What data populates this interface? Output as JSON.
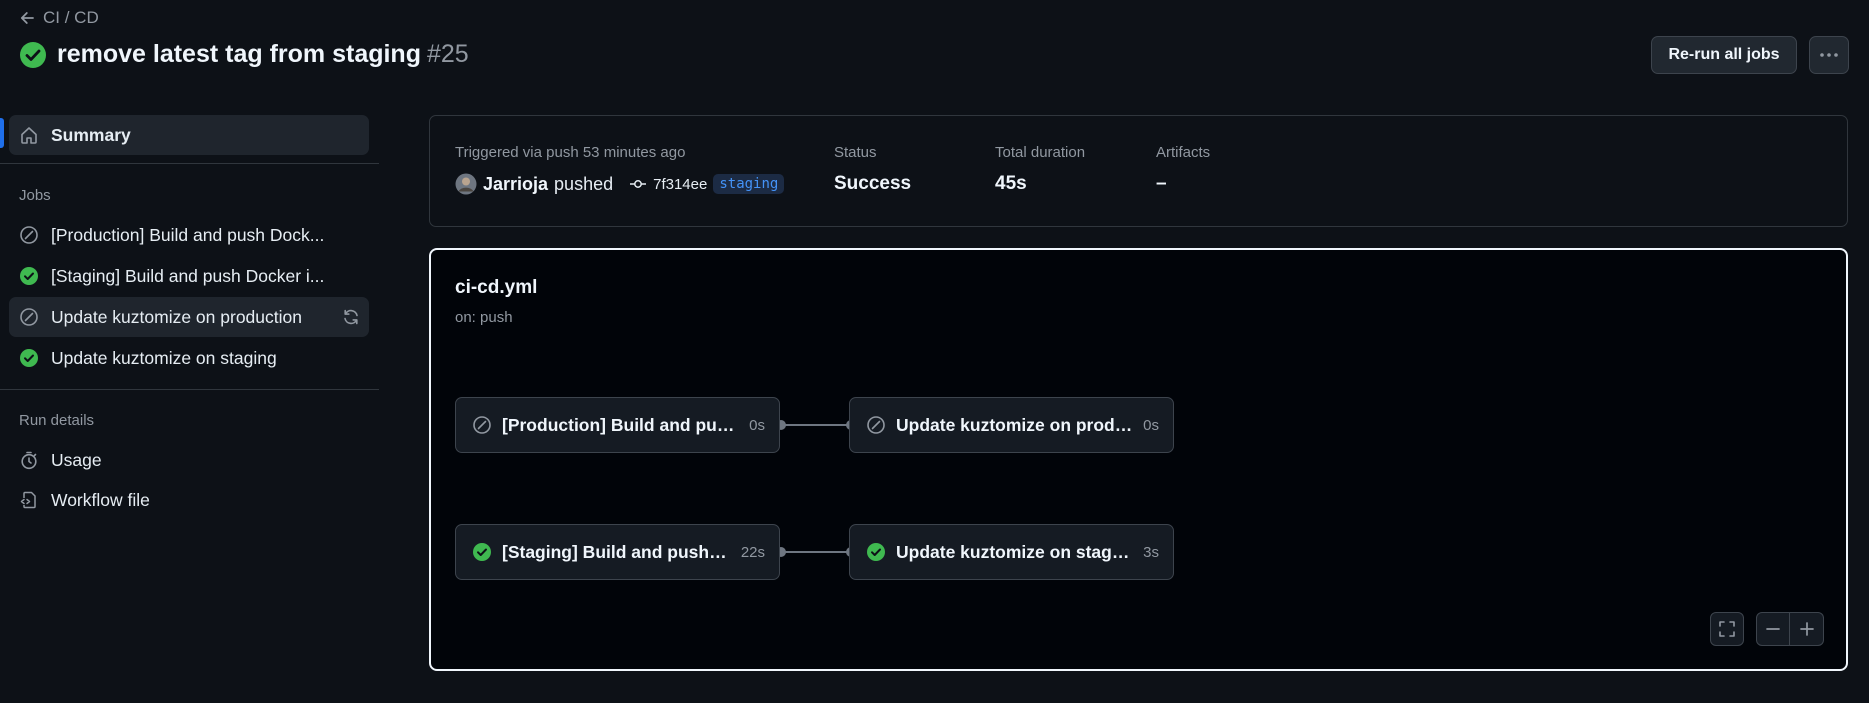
{
  "header": {
    "back_label": "CI / CD",
    "title": "remove latest tag from staging",
    "run_number": "#25",
    "rerun_label": "Re-run all jobs"
  },
  "sidebar": {
    "summary_label": "Summary",
    "jobs_heading": "Jobs",
    "jobs": [
      {
        "label": "[Production] Build and push Dock...",
        "status": "skipped"
      },
      {
        "label": "[Staging] Build and push Docker i...",
        "status": "success"
      },
      {
        "label": "Update kuztomize on production",
        "status": "skipped"
      },
      {
        "label": "Update kuztomize on staging",
        "status": "success"
      }
    ],
    "run_details_heading": "Run details",
    "usage_label": "Usage",
    "workflow_file_label": "Workflow file"
  },
  "summary": {
    "triggered_label": "Triggered via push 53 minutes ago",
    "actor": "Jarrioja",
    "action": "pushed",
    "commit": "7f314ee",
    "branch": "staging",
    "status_label": "Status",
    "status_value": "Success",
    "duration_label": "Total duration",
    "duration_value": "45s",
    "artifacts_label": "Artifacts",
    "artifacts_value": "–"
  },
  "graph": {
    "file": "ci-cd.yml",
    "trigger": "on: push",
    "nodes": [
      {
        "name": "[Production] Build and push ...",
        "duration": "0s",
        "status": "skipped"
      },
      {
        "name": "Update kuztomize on produ...",
        "duration": "0s",
        "status": "skipped"
      },
      {
        "name": "[Staging] Build and push D...",
        "duration": "22s",
        "status": "success"
      },
      {
        "name": "Update kuztomize on staging",
        "duration": "3s",
        "status": "success"
      }
    ]
  },
  "colors": {
    "success": "#3fb950",
    "accent": "#1f6feb",
    "background": "#0d1117"
  },
  "icons": {
    "back": "arrow-left-icon",
    "success": "check-circle-icon",
    "skipped": "skip-icon",
    "home": "home-icon",
    "sync": "sync-icon",
    "stopwatch": "stopwatch-icon",
    "file_code": "file-code-icon",
    "commit": "git-commit-icon",
    "more": "kebab-horizontal-icon",
    "fullscreen": "fullscreen-icon",
    "zoom_out": "minus-icon",
    "zoom_in": "plus-icon"
  }
}
